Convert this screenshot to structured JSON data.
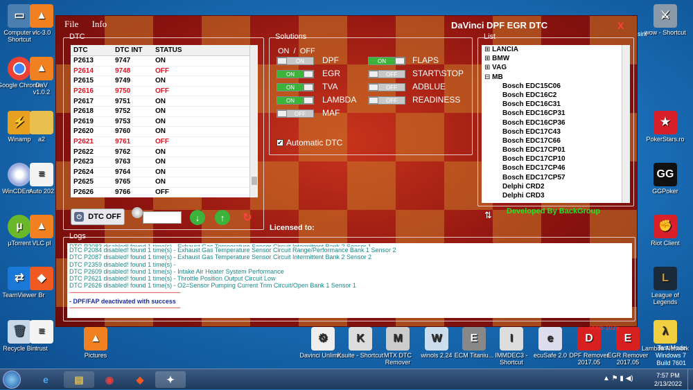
{
  "desktop": {
    "left_icons": [
      "Computer - Shortcut",
      "Google Chrome",
      "Winamp",
      "WinCDEm...",
      "µTorrent",
      "TeamViewer",
      "Recycle Bin"
    ],
    "left_col2": [
      "vlc-3.0",
      "DaV v1.0.2",
      "a2",
      "Auto 202",
      "VLC pl",
      "Br",
      "trust"
    ],
    "right_icons": [
      "wow - Shortcut",
      "PokerStars.ro",
      "GGPoker",
      "Riot Client",
      "League of Legends",
      "Lambda Network"
    ],
    "bottom_icons": [
      "Pictures",
      "Davinci Unlimit...",
      "Ksuite - Shortcut",
      "MTX DTC Remover",
      "winols 2.24",
      "ECM Titaniu...",
      "IMMDEC3 - Shortcut",
      "ecuSafe 2.0",
      "DPF Remover 2017.05",
      "EGR Remover 2017.05"
    ],
    "top_right_label": "sini",
    "watermark": "Test Mode\nWindows 7\nBuild 7601"
  },
  "app": {
    "menu": [
      "File",
      "Info"
    ],
    "title": "DaVinci DPF EGR DTC",
    "close": "X",
    "dtc": {
      "group_label": "DTC",
      "headers": [
        "DTC",
        "DTC INT",
        "STATUS"
      ],
      "rows": [
        {
          "dtc": "P2613",
          "int": "9747",
          "status": "ON",
          "red": false
        },
        {
          "dtc": "P2614",
          "int": "9748",
          "status": "OFF",
          "red": true
        },
        {
          "dtc": "P2615",
          "int": "9749",
          "status": "ON",
          "red": false
        },
        {
          "dtc": "P2616",
          "int": "9750",
          "status": "OFF",
          "red": true
        },
        {
          "dtc": "P2617",
          "int": "9751",
          "status": "ON",
          "red": false
        },
        {
          "dtc": "P2618",
          "int": "9752",
          "status": "ON",
          "red": false
        },
        {
          "dtc": "P2619",
          "int": "9753",
          "status": "ON",
          "red": false
        },
        {
          "dtc": "P2620",
          "int": "9760",
          "status": "ON",
          "red": false
        },
        {
          "dtc": "P2621",
          "int": "9761",
          "status": "OFF",
          "red": true
        },
        {
          "dtc": "P2622",
          "int": "9762",
          "status": "ON",
          "red": false
        },
        {
          "dtc": "P2623",
          "int": "9763",
          "status": "ON",
          "red": false
        },
        {
          "dtc": "P2624",
          "int": "9764",
          "status": "ON",
          "red": false
        },
        {
          "dtc": "P2625",
          "int": "9765",
          "status": "ON",
          "red": false
        },
        {
          "dtc": "P2626",
          "int": "9766",
          "status": "OFF",
          "red": false
        }
      ],
      "dtc_off_label": "DTC OFF",
      "search_value": ""
    },
    "solutions": {
      "group_label": "Solutions",
      "onoff_header": "ON  /  OFF",
      "left": [
        {
          "label": "DPF",
          "state": "ON",
          "on": false
        },
        {
          "label": "EGR",
          "state": "ON",
          "on": true
        },
        {
          "label": "TVA",
          "state": "ON",
          "on": true
        },
        {
          "label": "LAMBDA",
          "state": "ON",
          "on": true
        },
        {
          "label": "MAF",
          "state": "OFF",
          "on": false
        }
      ],
      "right": [
        {
          "label": "FLAPS",
          "state": "ON",
          "on": true
        },
        {
          "label": "START\\STOP",
          "state": "OFF",
          "on": false
        },
        {
          "label": "ADBLUE",
          "state": "OFF",
          "on": false
        },
        {
          "label": "READINESS",
          "state": "OFF",
          "on": false
        }
      ],
      "auto_dtc": "Automatic DTC",
      "licensed": "Licensed to:"
    },
    "list": {
      "group_label": "List",
      "items": [
        {
          "text": "LANCIA",
          "level": 0,
          "sign": "+"
        },
        {
          "text": "BMW",
          "level": 0,
          "sign": "+"
        },
        {
          "text": "VAG",
          "level": 0,
          "sign": "+"
        },
        {
          "text": "MB",
          "level": 0,
          "sign": "−"
        },
        {
          "text": "Bosch EDC15C06",
          "level": 1
        },
        {
          "text": "Bosch EDC16C2",
          "level": 1
        },
        {
          "text": "Bosch EDC16C31",
          "level": 1
        },
        {
          "text": "Bosch EDC16CP31",
          "level": 1
        },
        {
          "text": "Bosch EDC16CP36",
          "level": 1
        },
        {
          "text": "Bosch EDC17C43",
          "level": 1
        },
        {
          "text": "Bosch EDC17C66",
          "level": 1
        },
        {
          "text": "Bosch EDC17CP01",
          "level": 1
        },
        {
          "text": "Bosch EDC17CP10",
          "level": 1
        },
        {
          "text": "Bosch EDC17CP46",
          "level": 1
        },
        {
          "text": "Bosch EDC17CP57",
          "level": 1
        },
        {
          "text": "Delphi CRD2",
          "level": 1
        },
        {
          "text": "Delphi CRD3",
          "level": 1
        }
      ],
      "developed_by": "Developed By BackGroup"
    },
    "logs": {
      "group_label": "Logs",
      "lines": [
        "DTC P2084 disabled! found 1 time(s) - Exhaust Gas Temperature Sensor Circuit Range/Performance Bank 1 Sensor 2",
        "DTC P2087 disabled! found 1 time(s) - Exhaust Gas Temperature Sensor Circuit Intermittent Bank 2 Sensor 2",
        "DTC P2359 disabled! found 1 time(s) -",
        "DTC P2609 disabled! found 1 time(s) - Intake Air Heater System Performance",
        "DTC P2621 disabled! found 1 time(s) - Throttle Position Output Circuit Low",
        "DTC P2626 disabled! found 1 time(s) - O2=Sensor Pumping Current Trim Circuit/Open Bank 1 Sensor 1"
      ],
      "result": "-   DPF/FAP deactivated with success"
    },
    "status_code": "0008 1026"
  },
  "taskbar": {
    "time": "7:57 PM",
    "date": "2/13/2022"
  }
}
